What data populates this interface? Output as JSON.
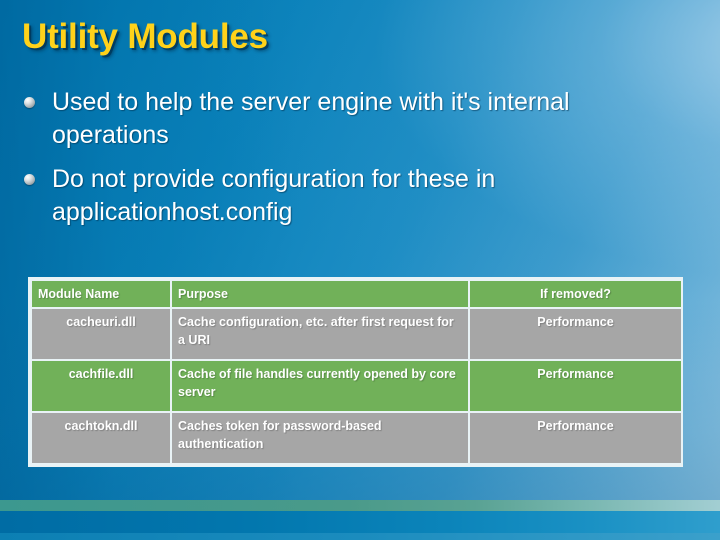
{
  "slide": {
    "title": "Utility Modules",
    "bullets": [
      "Used to help the server engine with it's internal operations",
      "Do not provide configuration for these in applicationhost.config"
    ]
  },
  "table": {
    "headers": {
      "module_name": "Module Name",
      "purpose": "Purpose",
      "if_removed": "If removed?"
    },
    "rows": [
      {
        "module_name": "cacheuri.dll",
        "purpose": "Cache configuration, etc. after first request for a URI",
        "if_removed": "Performance"
      },
      {
        "module_name": "cachfile.dll",
        "purpose": "Cache of file handles currently opened by core server",
        "if_removed": "Performance"
      },
      {
        "module_name": "cachtokn.dll",
        "purpose": "Caches token for password-based authentication",
        "if_removed": "Performance"
      }
    ]
  },
  "colors": {
    "title": "#ffd21a",
    "background_blue": "#0b7db5",
    "table_green": "#71b159",
    "table_grey": "#a6a6a6",
    "table_border": "#e9f3f6",
    "accent_band_green": "#4c9b87"
  }
}
